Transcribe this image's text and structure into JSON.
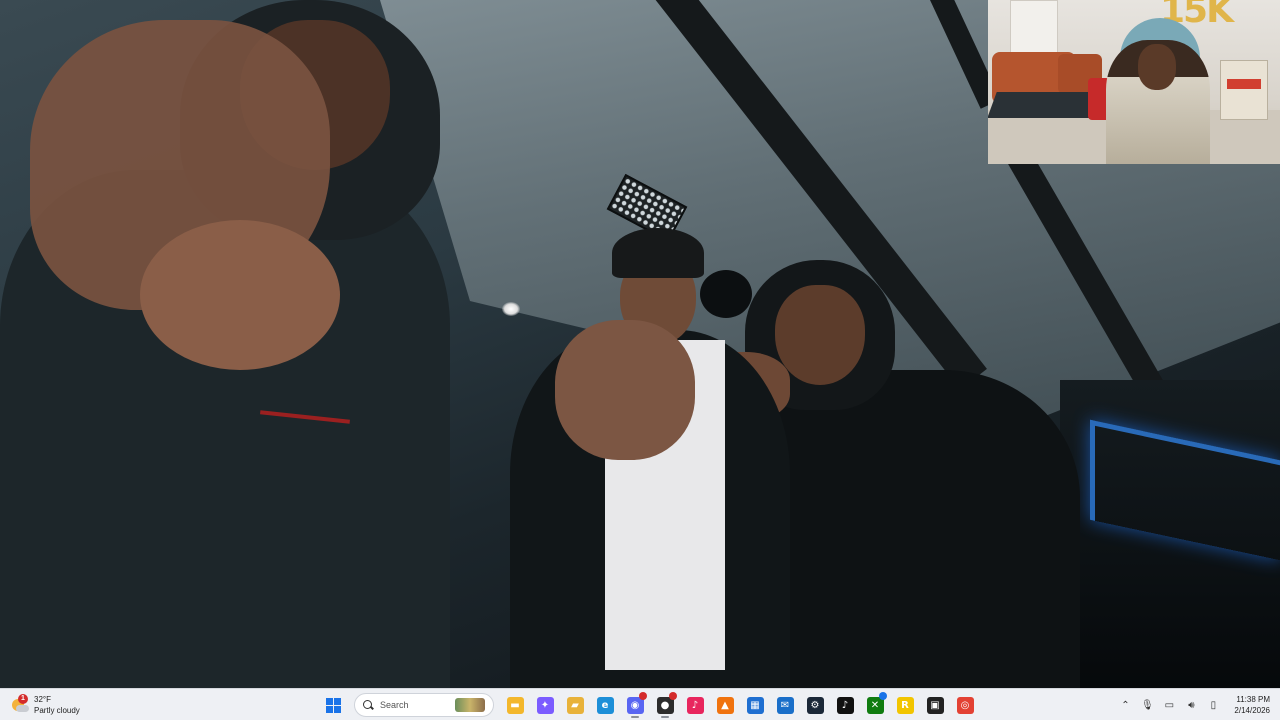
{
  "weather": {
    "temperature": "32°F",
    "condition": "Partly cloudy",
    "badge_count": "1"
  },
  "webcam": {
    "balloon_text": "15K"
  },
  "taskbar": {
    "search_placeholder": "Search",
    "pinned_apps": [
      {
        "name": "file-explorer",
        "color": "#f3b72c",
        "glyph": "▬"
      },
      {
        "name": "copilot",
        "color": "#7b5cff",
        "glyph": "✦"
      },
      {
        "name": "folder",
        "color": "#e8b23a",
        "glyph": "▰"
      },
      {
        "name": "edge",
        "color": "#1d8fd8",
        "glyph": "e"
      },
      {
        "name": "discord",
        "color": "#5865f2",
        "glyph": "◉"
      },
      {
        "name": "obs",
        "color": "#2c2c2c",
        "glyph": "●"
      },
      {
        "name": "tiktok-live",
        "color": "#e8265e",
        "glyph": "♪"
      },
      {
        "name": "vlc",
        "color": "#f0730f",
        "glyph": "▲"
      },
      {
        "name": "store",
        "color": "#1f6fd1",
        "glyph": "▦"
      },
      {
        "name": "mail",
        "color": "#1a6fc9",
        "glyph": "✉"
      },
      {
        "name": "steam",
        "color": "#1b2838",
        "glyph": "⚙"
      },
      {
        "name": "tiktok",
        "color": "#111111",
        "glyph": "♪"
      },
      {
        "name": "xbox",
        "color": "#107c10",
        "glyph": "✕"
      },
      {
        "name": "rockstar",
        "color": "#f2c500",
        "glyph": "R"
      },
      {
        "name": "media-app",
        "color": "#222222",
        "glyph": "▣"
      },
      {
        "name": "chrome",
        "color": "#e34133",
        "glyph": "◎"
      }
    ]
  },
  "tray": {
    "time": "11:38 PM",
    "date": "2/14/2026"
  }
}
